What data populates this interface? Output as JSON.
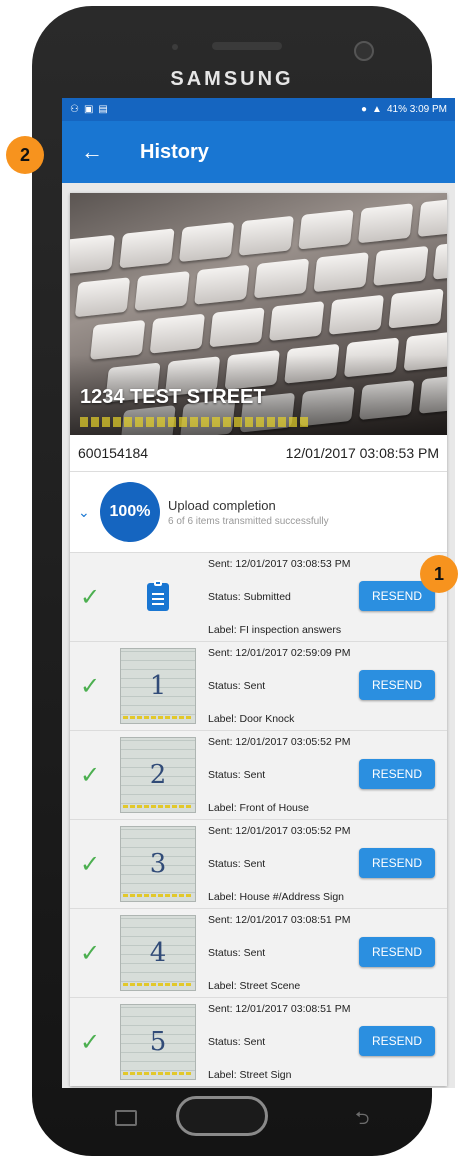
{
  "phone": {
    "brand": "SAMSUNG"
  },
  "statusbar": {
    "icons_left": [
      "network-icon",
      "image-icon",
      "file-icon"
    ],
    "right_text": "41% 3:09 PM"
  },
  "appbar": {
    "back_glyph": "←",
    "title": "History"
  },
  "header": {
    "address": "1234 TEST STREET",
    "id": "600154184",
    "datetime": "12/01/2017 03:08:53 PM"
  },
  "upload": {
    "percent": "100%",
    "title": "Upload completion",
    "subtitle": "6 of 6 items transmitted successfully"
  },
  "items": [
    {
      "sent": "Sent: 12/01/2017 03:08:53 PM",
      "status": "Status: Submitted",
      "label": "Label: FI inspection answers",
      "button": "RESEND",
      "thumb": "clipboard-icon",
      "digit": ""
    },
    {
      "sent": "Sent: 12/01/2017 02:59:09 PM",
      "status": "Status: Sent",
      "label": "Label: Door Knock",
      "button": "RESEND",
      "thumb": "photo",
      "digit": "1"
    },
    {
      "sent": "Sent: 12/01/2017 03:05:52 PM",
      "status": "Status: Sent",
      "label": "Label: Front of House",
      "button": "RESEND",
      "thumb": "photo",
      "digit": "2"
    },
    {
      "sent": "Sent: 12/01/2017 03:05:52 PM",
      "status": "Status: Sent",
      "label": "Label: House #/Address Sign",
      "button": "RESEND",
      "thumb": "photo",
      "digit": "3"
    },
    {
      "sent": "Sent: 12/01/2017 03:08:51 PM",
      "status": "Status: Sent",
      "label": "Label: Street Scene",
      "button": "RESEND",
      "thumb": "photo",
      "digit": "4"
    },
    {
      "sent": "Sent: 12/01/2017 03:08:51 PM",
      "status": "Status: Sent",
      "label": "Label: Street Sign",
      "button": "RESEND",
      "thumb": "photo",
      "digit": "5"
    }
  ],
  "callouts": {
    "one": "1",
    "two": "2"
  },
  "colors": {
    "appbar": "#1976d2",
    "statusbar": "#1565c0",
    "resend": "#2b8fe0",
    "check": "#4caf50",
    "callout": "#f7931e"
  }
}
